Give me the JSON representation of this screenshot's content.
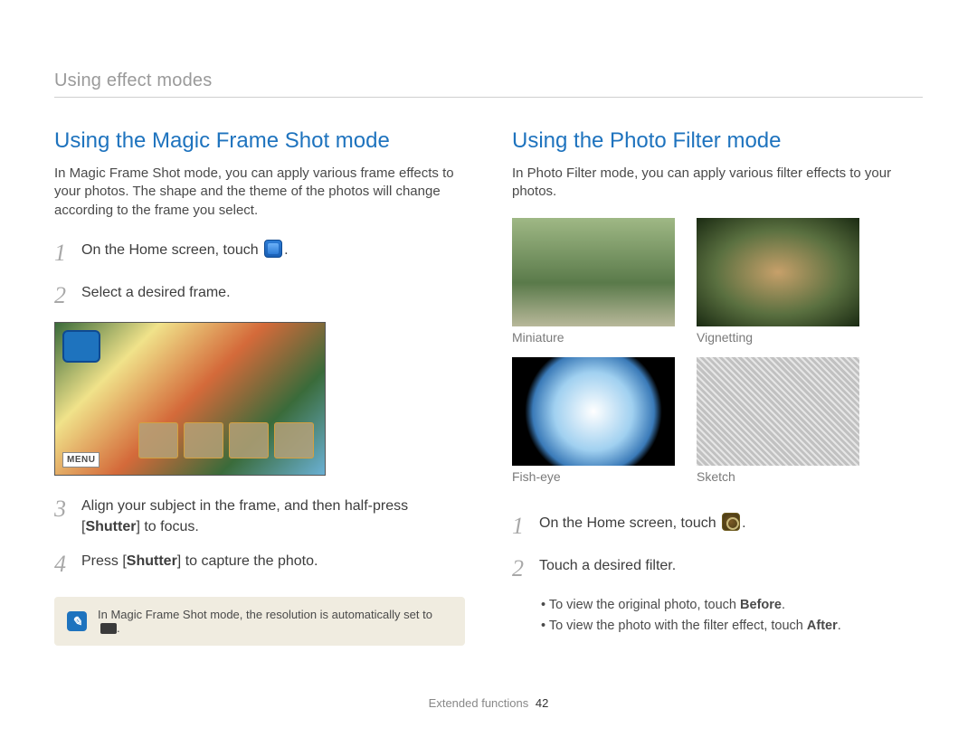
{
  "header": {
    "section": "Using effect modes"
  },
  "left": {
    "title": "Using the Magic Frame Shot mode",
    "intro": "In Magic Frame Shot mode, you can apply various frame effects to your photos. The shape and the theme of the photos will change according to the frame you select.",
    "steps": {
      "s1": {
        "num": "1",
        "text": "On the Home screen, touch "
      },
      "s2": {
        "num": "2",
        "text": "Select a desired frame."
      },
      "s3": {
        "num": "3",
        "pre": "Align your subject in the frame, and then half-press [",
        "bold": "Shutter",
        "post": "] to focus."
      },
      "s4": {
        "num": "4",
        "pre": "Press [",
        "bold": "Shutter",
        "post": "] to capture the photo."
      }
    },
    "menu_label": "MENU",
    "note": "In Magic Frame Shot mode, the resolution is automatically set to "
  },
  "right": {
    "title": "Using the Photo Filter mode",
    "intro": "In Photo Filter mode, you can apply various filter effects to your photos.",
    "captions": {
      "c1": "Miniature",
      "c2": "Vignetting",
      "c3": "Fish-eye",
      "c4": "Sketch"
    },
    "steps": {
      "s1": {
        "num": "1",
        "text": "On the Home screen, touch "
      },
      "s2": {
        "num": "2",
        "text": "Touch a desired filter."
      }
    },
    "bullets": {
      "b1": {
        "pre": "To view the original photo, touch ",
        "bold": "Before",
        "post": "."
      },
      "b2": {
        "pre": "To view the photo with the filter effect, touch ",
        "bold": "After",
        "post": "."
      }
    }
  },
  "footer": {
    "label": "Extended functions",
    "page": "42"
  }
}
